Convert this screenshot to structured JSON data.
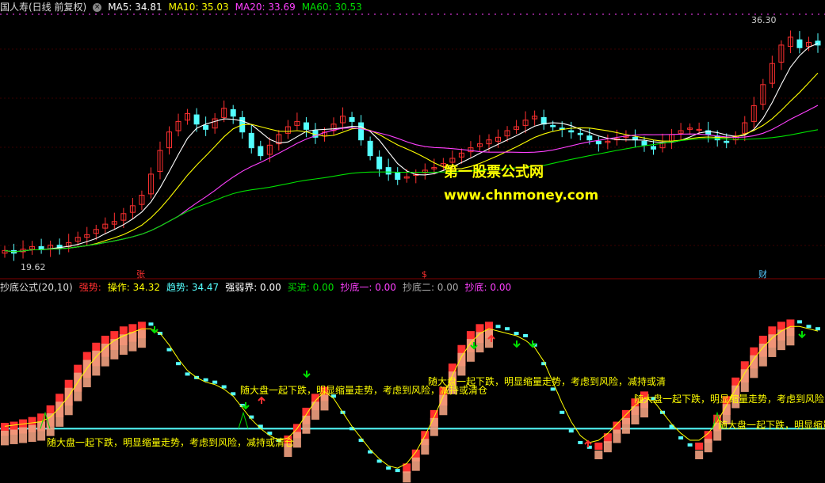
{
  "header": {
    "title": "国人寿(日线 前复权)",
    "ma5": "MA5: 34.81",
    "ma10": "MA10: 35.03",
    "ma20": "MA20: 33.69",
    "ma60": "MA60: 30.53"
  },
  "indicator_header": {
    "name": "抄底公式(20,10)",
    "strong": "强势:",
    "op": "操作: 34.32",
    "trend": "趋势: 34.47",
    "boundary": "强弱界: 0.00",
    "buy": "买进: 0.00",
    "bottom1": "抄底一: 0.00",
    "bottom2": "抄底二: 0.00",
    "bottom": "抄底: 0.00"
  },
  "labels": {
    "high": "36.30",
    "low": "19.62",
    "mark_zhang": "张",
    "mark_s": "$",
    "mark_cai": "财"
  },
  "watermark": {
    "line1": "第一股票公式网",
    "line2": "www.chnmoney.com"
  },
  "warning_text": "随大盘一起下跌，明显缩量走势，考虑到风险，减持或清仓",
  "colors": {
    "up": "#ff3030",
    "down": "#54ffff",
    "ma5": "#ffffff",
    "ma10": "#ffff00",
    "ma20": "#ff40ff",
    "ma60": "#00e000",
    "boundary": "#54ffff",
    "orange": "#f0a080"
  },
  "chart_data": [
    {
      "type": "candlestick",
      "title": "国人寿(日线 前复权)",
      "ylim": [
        18.5,
        37.5
      ],
      "max_label": 36.3,
      "min_label": 19.62,
      "series": [
        {
          "name": "MA5",
          "value": 34.81
        },
        {
          "name": "MA10",
          "value": 35.03
        },
        {
          "name": "MA20",
          "value": 33.69
        },
        {
          "name": "MA60",
          "value": 30.53
        }
      ],
      "close": [
        19.8,
        19.6,
        19.9,
        20.1,
        19.9,
        20.2,
        20.0,
        20.4,
        20.8,
        21.0,
        21.4,
        21.8,
        22.0,
        22.6,
        23.2,
        24.0,
        25.6,
        27.4,
        28.8,
        29.6,
        30.2,
        29.4,
        29.0,
        29.8,
        30.6,
        30.0,
        28.8,
        27.6,
        27.0,
        27.8,
        28.6,
        29.2,
        29.6,
        29.0,
        28.4,
        28.8,
        29.4,
        30.0,
        29.6,
        28.2,
        27.0,
        26.0,
        25.6,
        25.2,
        25.4,
        25.6,
        25.9,
        26.1,
        26.4,
        26.8,
        27.2,
        27.6,
        27.9,
        28.2,
        28.4,
        28.9,
        29.2,
        29.7,
        30.0,
        29.4,
        29.2,
        29.0,
        28.8,
        28.6,
        28.2,
        27.9,
        28.1,
        28.3,
        28.5,
        28.2,
        27.8,
        27.5,
        28.0,
        28.6,
        28.9,
        29.1,
        29.0,
        28.6,
        28.2,
        28.0,
        28.5,
        29.5,
        30.8,
        32.4,
        34.0,
        35.4,
        36.0,
        35.2,
        35.6,
        35.4
      ],
      "open": [
        19.6,
        19.8,
        19.7,
        19.9,
        20.1,
        19.9,
        20.2,
        20.1,
        20.5,
        20.8,
        21.1,
        21.5,
        21.8,
        22.1,
        22.7,
        23.3,
        24.1,
        25.8,
        27.6,
        28.9,
        29.7,
        30.1,
        29.3,
        29.1,
        29.9,
        30.5,
        29.9,
        28.7,
        27.7,
        27.1,
        27.9,
        28.7,
        29.3,
        29.5,
        28.9,
        28.5,
        28.9,
        29.5,
        29.9,
        29.5,
        28.1,
        26.9,
        26.1,
        25.7,
        25.3,
        25.5,
        25.7,
        26.0,
        26.2,
        26.5,
        26.9,
        27.3,
        27.7,
        27.9,
        28.1,
        28.5,
        29.0,
        29.3,
        29.8,
        29.9,
        29.3,
        29.1,
        28.9,
        28.7,
        28.5,
        28.1,
        28.0,
        28.2,
        28.4,
        28.4,
        28.1,
        27.7,
        27.6,
        28.1,
        28.7,
        29.0,
        29.0,
        28.9,
        28.5,
        28.1,
        28.2,
        28.7,
        29.6,
        30.9,
        32.5,
        34.1,
        35.3,
        35.8,
        35.3,
        35.7
      ]
    },
    {
      "type": "line",
      "title": "抄底公式(20,10)",
      "ylim": [
        -40,
        110
      ],
      "series": [
        {
          "name": "强势",
          "values": [
            5,
            6,
            8,
            10,
            13,
            20,
            30,
            42,
            55,
            66,
            74,
            80,
            84,
            88,
            90,
            92,
            90,
            82,
            68,
            56,
            47,
            44,
            42,
            40,
            36,
            30,
            20,
            10,
            2,
            -4,
            -10,
            -6,
            4,
            18,
            30,
            36,
            28,
            14,
            0,
            -10,
            -20,
            -28,
            -34,
            -36,
            -30,
            -18,
            -2,
            16,
            36,
            56,
            72,
            84,
            90,
            92,
            88,
            86,
            82,
            80,
            72,
            56,
            34,
            14,
            -2,
            -12,
            -16,
            -12,
            -4,
            6,
            16,
            26,
            32,
            26,
            14,
            2,
            -8,
            -14,
            -12,
            -2,
            12,
            28,
            44,
            58,
            70,
            80,
            88,
            92,
            94,
            92,
            88,
            86
          ]
        },
        {
          "name": "操作",
          "values": [
            2,
            3,
            4,
            5,
            6,
            10,
            18,
            28,
            40,
            52,
            62,
            70,
            76,
            80,
            83,
            86,
            86,
            82,
            72,
            60,
            50,
            44,
            40,
            38,
            34,
            28,
            18,
            8,
            0,
            -6,
            -10,
            -8,
            0,
            12,
            24,
            32,
            26,
            14,
            2,
            -8,
            -18,
            -26,
            -32,
            -34,
            -30,
            -20,
            -6,
            10,
            28,
            46,
            62,
            74,
            82,
            86,
            84,
            82,
            80,
            76,
            70,
            58,
            40,
            22,
            6,
            -6,
            -12,
            -10,
            -4,
            4,
            12,
            20,
            26,
            24,
            14,
            4,
            -4,
            -10,
            -10,
            -4,
            6,
            20,
            34,
            48,
            60,
            70,
            78,
            84,
            88,
            88,
            86,
            84
          ]
        },
        {
          "name": "强弱界",
          "values": [
            0
          ]
        },
        {
          "name": "买进",
          "values": [
            0
          ]
        },
        {
          "name": "抄底一",
          "values": [
            0
          ]
        },
        {
          "name": "抄底二",
          "values": [
            0
          ]
        },
        {
          "name": "抄底",
          "values": [
            0
          ]
        }
      ]
    }
  ]
}
